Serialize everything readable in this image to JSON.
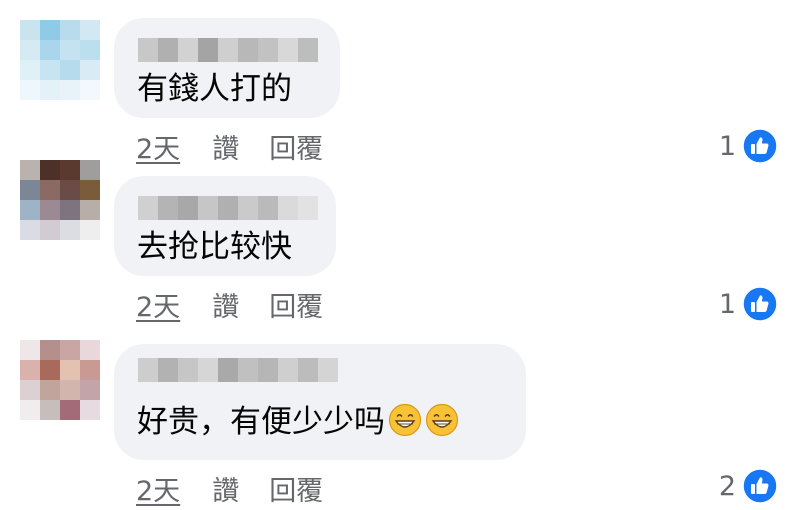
{
  "comments": [
    {
      "text": "有錢人打的",
      "time": "2天",
      "like_label": "讚",
      "reply_label": "回覆",
      "reaction_count": "1",
      "reaction_icon": "thumbs-up-icon",
      "emoji": []
    },
    {
      "text": "去抢比较快",
      "time": "2天",
      "like_label": "讚",
      "reply_label": "回覆",
      "reaction_count": "1",
      "reaction_icon": "thumbs-up-icon",
      "emoji": []
    },
    {
      "text": "好贵，有便少少吗",
      "time": "2天",
      "like_label": "讚",
      "reply_label": "回覆",
      "reaction_count": "2",
      "reaction_icon": "thumbs-up-icon",
      "emoji": [
        "grinning-face-emoji",
        "grinning-face-emoji"
      ]
    }
  ],
  "colors": {
    "bubble_bg": "#f0f2f5",
    "meta_text": "#65676b",
    "like_blue": "#1877f2"
  }
}
